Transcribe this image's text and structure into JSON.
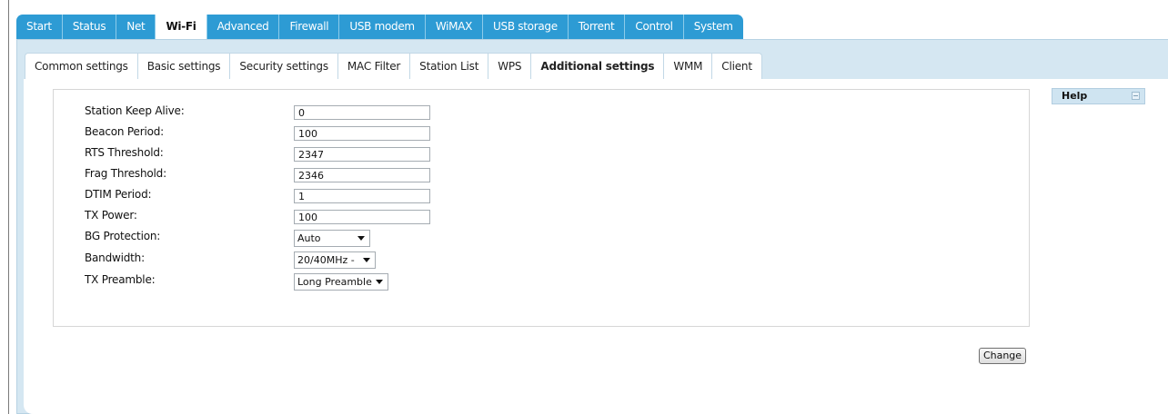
{
  "main_tabs": [
    "Start",
    "Status",
    "Net",
    "Wi-Fi",
    "Advanced",
    "Firewall",
    "USB modem",
    "WiMAX",
    "USB storage",
    "Torrent",
    "Control",
    "System"
  ],
  "main_active": "Wi-Fi",
  "sub_tabs": [
    "Common settings",
    "Basic settings",
    "Security settings",
    "MAC Filter",
    "Station List",
    "WPS",
    "Additional settings",
    "WMM",
    "Client"
  ],
  "sub_active": "Additional settings",
  "form": {
    "station_keep_alive": {
      "label": "Station Keep Alive:",
      "value": "0"
    },
    "beacon_period": {
      "label": "Beacon Period:",
      "value": "100"
    },
    "rts_threshold": {
      "label": "RTS Threshold:",
      "value": "2347"
    },
    "frag_threshold": {
      "label": "Frag Threshold:",
      "value": "2346"
    },
    "dtim_period": {
      "label": "DTIM Period:",
      "value": "1"
    },
    "tx_power": {
      "label": "TX Power:",
      "value": "100"
    },
    "bg_protection": {
      "label": "BG Protection:",
      "value": "Auto"
    },
    "bandwidth": {
      "label": "Bandwidth:",
      "value": "20/40MHz -"
    },
    "tx_preamble": {
      "label": "TX Preamble:",
      "value": "Long Preamble"
    }
  },
  "change_label": "Change",
  "help_title": "Help",
  "colors": {
    "tab_blue": "#2d9bd4",
    "panel_bg": "#d5e7f2",
    "active_tab_bg": "#ffffff"
  }
}
